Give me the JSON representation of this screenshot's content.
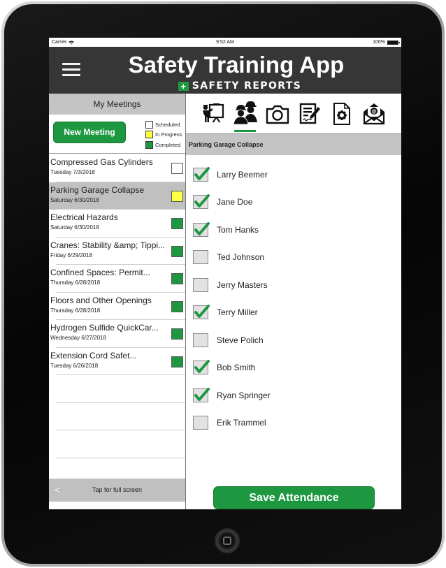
{
  "status_bar": {
    "carrier": "Carrier",
    "time": "9:52 AM",
    "battery": "100%"
  },
  "header": {
    "title": "Safety Training App",
    "brand_icon": "+",
    "brand_text": "SAFETY REPORTS",
    "menu_icon": "hamburger-icon"
  },
  "left_pane": {
    "title": "My Meetings",
    "new_meeting_label": "New Meeting",
    "legend": [
      {
        "label": "Scheduled",
        "color": "#ffffff"
      },
      {
        "label": "In Progress",
        "color": "#ffff44"
      },
      {
        "label": "Completed",
        "color": "#1e9840"
      }
    ],
    "meetings": [
      {
        "name": "Compressed Gas Cylinders",
        "date": "Tuesday 7/3/2018",
        "status": "Scheduled",
        "color": "#ffffff",
        "selected": false
      },
      {
        "name": "Parking Garage Collapse",
        "date": "Saturday 6/30/2018",
        "status": "In Progress",
        "color": "#ffff44",
        "selected": true
      },
      {
        "name": "Electrical Hazards",
        "date": "Saturday 6/30/2018",
        "status": "Completed",
        "color": "#1e9840",
        "selected": false
      },
      {
        "name": "Cranes: Stability &amp; Tippi...",
        "date": "Friday 6/29/2018",
        "status": "Completed",
        "color": "#1e9840",
        "selected": false
      },
      {
        "name": "Confined Spaces: Permit...",
        "date": "Thursday 6/28/2018",
        "status": "Completed",
        "color": "#1e9840",
        "selected": false
      },
      {
        "name": "Floors and Other Openings",
        "date": "Thursday 6/28/2018",
        "status": "Completed",
        "color": "#1e9840",
        "selected": false
      },
      {
        "name": "Hydrogen Sulfide QuickCar...",
        "date": "Wednesday 6/27/2018",
        "status": "Completed",
        "color": "#1e9840",
        "selected": false
      },
      {
        "name": "Extension Cord Safet...",
        "date": "Tuesday 6/26/2018",
        "status": "Completed",
        "color": "#1e9840",
        "selected": false
      }
    ],
    "fullscreen_label": "Tap for full screen",
    "back_icon": "<"
  },
  "right_pane": {
    "tabs": [
      {
        "icon": "presenter-icon",
        "active": false
      },
      {
        "icon": "workers-icon",
        "active": true
      },
      {
        "icon": "camera-icon",
        "active": false
      },
      {
        "icon": "sign-document-icon",
        "active": false
      },
      {
        "icon": "document-settings-icon",
        "active": false
      },
      {
        "icon": "email-icon",
        "active": false
      }
    ],
    "meeting_title": "Parking Garage Collapse",
    "attendees": [
      {
        "name": "Larry Beemer",
        "present": true
      },
      {
        "name": "Jane Doe",
        "present": true
      },
      {
        "name": "Tom Hanks",
        "present": true
      },
      {
        "name": "Ted Johnson",
        "present": false
      },
      {
        "name": "Jerry Masters",
        "present": false
      },
      {
        "name": "Terry Miller",
        "present": true
      },
      {
        "name": "Steve Polich",
        "present": false
      },
      {
        "name": "Bob Smith",
        "present": true
      },
      {
        "name": "Ryan Springer",
        "present": true
      },
      {
        "name": "Erik Trammel",
        "present": false
      }
    ],
    "save_label": "Save Attendance"
  },
  "colors": {
    "accent_green": "#1e9840",
    "header_bg": "#363636",
    "in_progress_yellow": "#ffff44"
  }
}
